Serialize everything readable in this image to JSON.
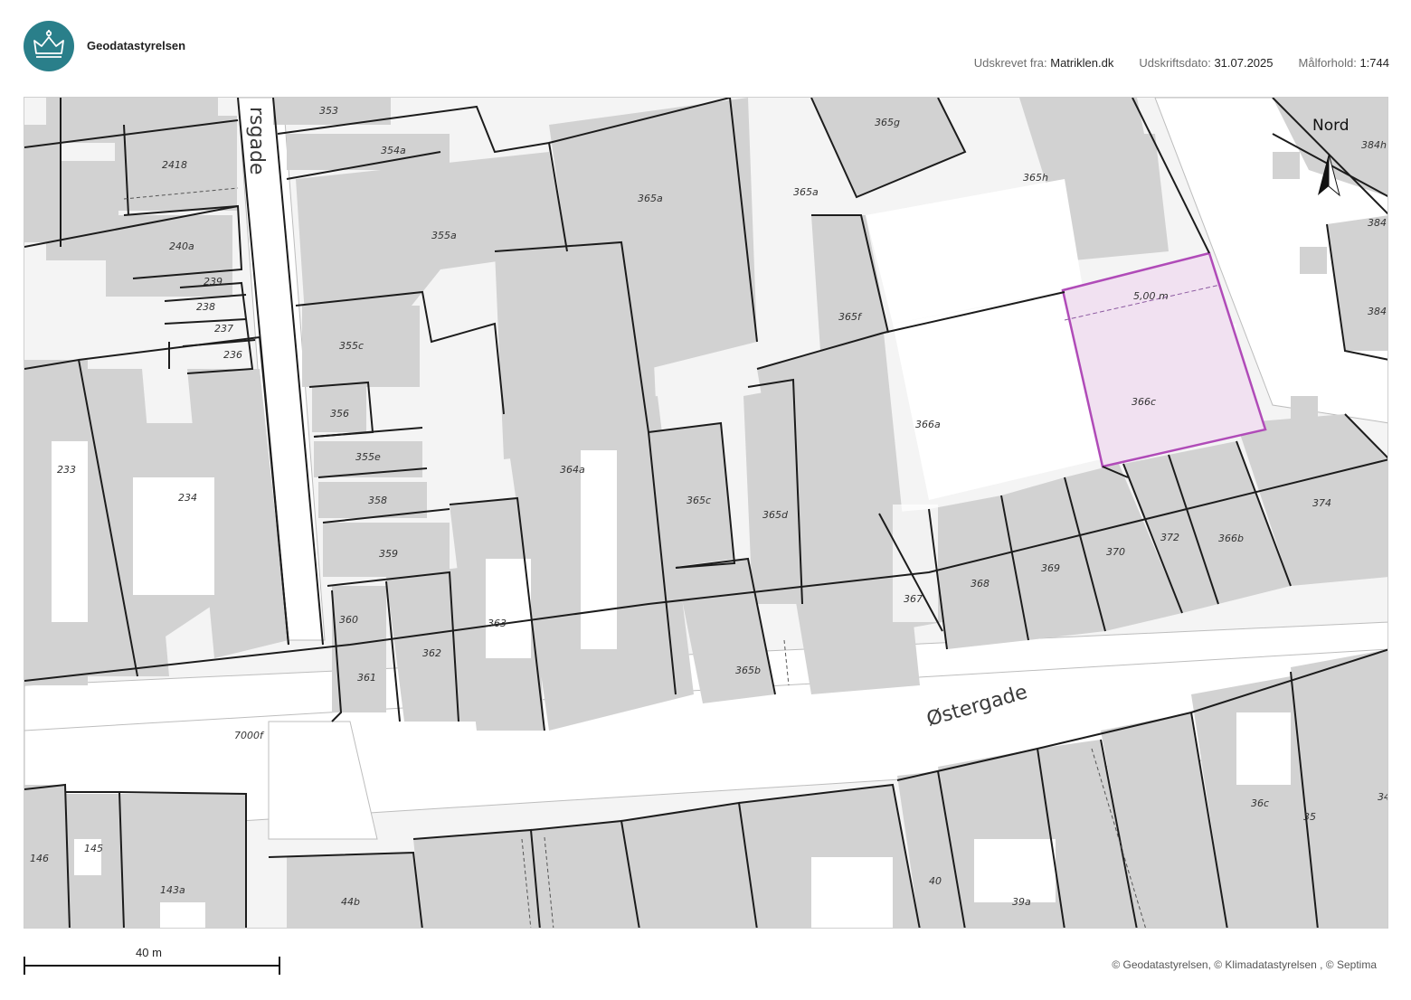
{
  "header": {
    "org": "Geodatastyrelsen",
    "source_label": "Udskrevet fra:",
    "source_value": "Matriklen.dk",
    "date_label": "Udskriftsdato:",
    "date_value": "31.07.2025",
    "scale_label": "Målforhold:",
    "scale_value": "1:744"
  },
  "map": {
    "north_label": "Nord",
    "streets": {
      "main": "Østergade",
      "side": "rsgade"
    },
    "highlight": {
      "parcel": "366c",
      "measure": "5,00 m",
      "color": "#b04bb8",
      "fill": "#f1e1f1"
    },
    "parcels": [
      "353",
      "354a",
      "2418",
      "240a",
      "239",
      "238",
      "237",
      "236",
      "233",
      "234",
      "355a",
      "355c",
      "356",
      "355e",
      "358",
      "359",
      "360",
      "361",
      "362",
      "363",
      "364a",
      "365a",
      "365a",
      "365g",
      "365h",
      "365f",
      "365c",
      "365d",
      "365b",
      "366a",
      "367",
      "368",
      "369",
      "370",
      "372",
      "366b",
      "374",
      "384h",
      "384",
      "384",
      "7000f",
      "146",
      "145",
      "143a",
      "44b",
      "40",
      "39a",
      "36c",
      "35",
      "34"
    ],
    "colors": {
      "building": "#d2d2d2",
      "road": "#ffffff",
      "line": "#1c1c1c",
      "background": "#f4f4f4"
    }
  },
  "scalebar": {
    "label": "40 m"
  },
  "footer": {
    "copyright": "© Geodatastyrelsen, © Klimadatastyrelsen , © Septima"
  }
}
